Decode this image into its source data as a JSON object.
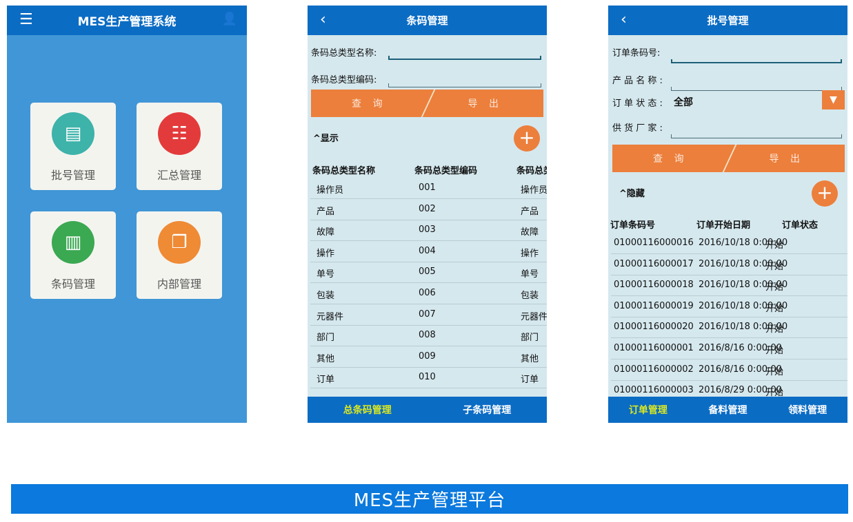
{
  "home": {
    "title": "MES生产管理系统",
    "menu_icon": "list-icon",
    "user_icon": "user-list-icon",
    "tiles": [
      {
        "label": "批号管理",
        "icon": "documents-icon",
        "color": "#3db3aa"
      },
      {
        "label": "汇总管理",
        "icon": "checklist-refresh-icon",
        "color": "#e33b3b"
      },
      {
        "label": "条码管理",
        "icon": "barcode-icon",
        "color": "#3ba852"
      },
      {
        "label": "内部管理",
        "icon": "copy-docs-icon",
        "color": "#ef8a35"
      }
    ]
  },
  "barcode": {
    "title": "条码管理",
    "f1": "条码总类型名称:",
    "f2": "条码总类型编码:",
    "query": "查 询",
    "export": "导 出",
    "toggle": "显示",
    "headers": [
      "条码总类型名称",
      "条码总类型编码",
      "条码总类"
    ],
    "rows": [
      [
        "操作员",
        "001",
        "操作员"
      ],
      [
        "产品",
        "002",
        "产品"
      ],
      [
        "故障",
        "003",
        "故障"
      ],
      [
        "操作",
        "004",
        "操作"
      ],
      [
        "单号",
        "005",
        "单号"
      ],
      [
        "包装",
        "006",
        "包装"
      ],
      [
        "元器件",
        "007",
        "元器件"
      ],
      [
        "部门",
        "008",
        "部门"
      ],
      [
        "其他",
        "009",
        "其他"
      ],
      [
        "订单",
        "010",
        "订单"
      ]
    ],
    "tabs": [
      "总条码管理",
      "子条码管理"
    ]
  },
  "batch": {
    "title": "批号管理",
    "f1": "订单条码号:",
    "f2": "产 品 名 称 :",
    "f3": "订 单 状 态 :",
    "status_value": "全部",
    "f4": "供 货 厂 家 :",
    "query": "查 询",
    "export": "导 出",
    "toggle": "隐藏",
    "headers": [
      "订单条码号",
      "订单开始日期",
      "订单状态"
    ],
    "rows": [
      [
        "01000116000016",
        "2016/10/18 0:00:00",
        "开始"
      ],
      [
        "01000116000017",
        "2016/10/18 0:00:00",
        "开始"
      ],
      [
        "01000116000018",
        "2016/10/18 0:00:00",
        "开始"
      ],
      [
        "01000116000019",
        "2016/10/18 0:00:00",
        "开始"
      ],
      [
        "01000116000020",
        "2016/10/18 0:00:00",
        "开始"
      ],
      [
        "01000116000001",
        "2016/8/16 0:00:00",
        "开始"
      ],
      [
        "01000116000002",
        "2016/8/16 0:00:00",
        "开始"
      ],
      [
        "01000116000003",
        "2016/8/29 0:00:00",
        "开始"
      ]
    ],
    "tabs": [
      "订单管理",
      "备料管理",
      "领料管理"
    ]
  },
  "banner": "MES生产管理平台",
  "colors": {
    "header": "#0b6cc4",
    "accent": "#ec7f3c",
    "active_tab": "#dbe81f"
  }
}
